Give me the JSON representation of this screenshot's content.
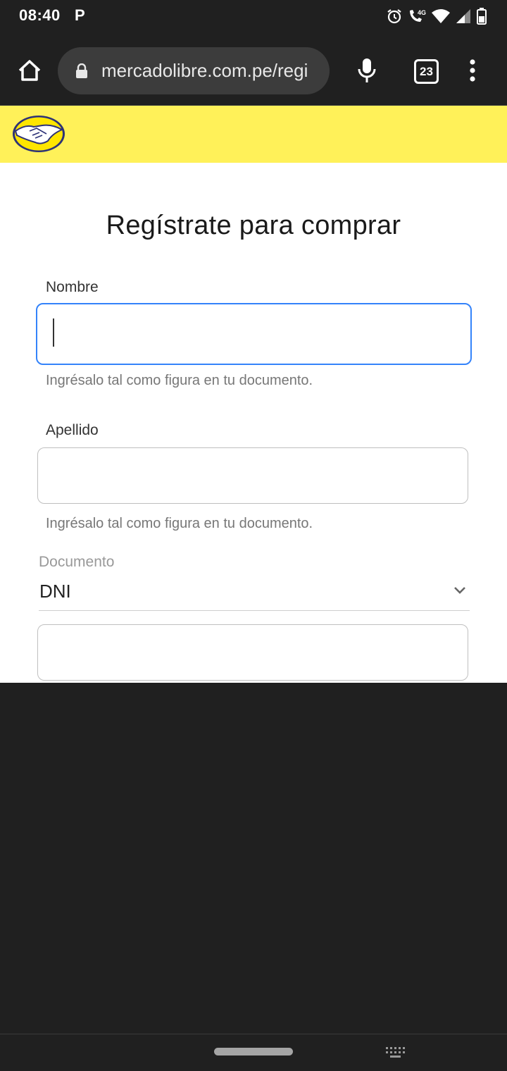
{
  "status_bar": {
    "time": "08:40",
    "notification_letter": "P",
    "icons": [
      "alarm-icon",
      "wifi-call-icon",
      "wifi-icon",
      "signal-icon",
      "battery-icon"
    ],
    "network": "4G"
  },
  "browser": {
    "url": "mercadolibre.com.pe/regi",
    "tab_count": "23",
    "icons": [
      "home-icon",
      "lock-icon",
      "mic-icon",
      "tabs-icon",
      "more-icon"
    ]
  },
  "header": {
    "brand_color": "#fff159",
    "logo": "mercadolibre-handshake-logo"
  },
  "form": {
    "title": "Regístrate para comprar",
    "nombre": {
      "label": "Nombre",
      "value": "",
      "helper": "Ingrésalo tal como figura en tu documento."
    },
    "apellido": {
      "label": "Apellido",
      "value": "",
      "helper": "Ingrésalo tal como figura en tu documento."
    },
    "documento": {
      "label": "Documento",
      "selected": "DNI"
    },
    "numero": {
      "value": ""
    },
    "accent_color": "#3483fa"
  },
  "nav": {
    "icons": [
      "home-pill",
      "keyboard-icon"
    ]
  }
}
